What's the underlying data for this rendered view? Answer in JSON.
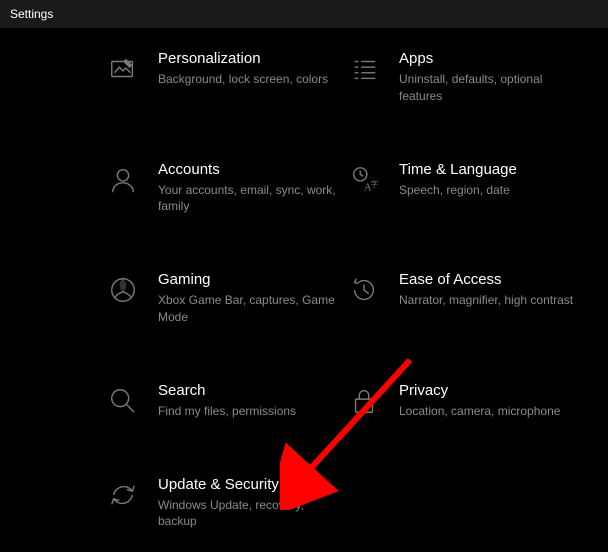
{
  "window": {
    "title": "Settings"
  },
  "categories": [
    {
      "icon": "personalization-icon",
      "title": "Personalization",
      "desc": "Background, lock screen, colors"
    },
    {
      "icon": "apps-icon",
      "title": "Apps",
      "desc": "Uninstall, defaults, optional features"
    },
    {
      "icon": "accounts-icon",
      "title": "Accounts",
      "desc": "Your accounts, email, sync, work, family"
    },
    {
      "icon": "time-language-icon",
      "title": "Time & Language",
      "desc": "Speech, region, date"
    },
    {
      "icon": "gaming-icon",
      "title": "Gaming",
      "desc": "Xbox Game Bar, captures, Game Mode"
    },
    {
      "icon": "ease-of-access-icon",
      "title": "Ease of Access",
      "desc": "Narrator, magnifier, high contrast"
    },
    {
      "icon": "search-icon",
      "title": "Search",
      "desc": "Find my files, permissions"
    },
    {
      "icon": "privacy-icon",
      "title": "Privacy",
      "desc": "Location, camera, microphone"
    },
    {
      "icon": "update-security-icon",
      "title": "Update & Security",
      "desc": "Windows Update, recovery, backup"
    }
  ]
}
